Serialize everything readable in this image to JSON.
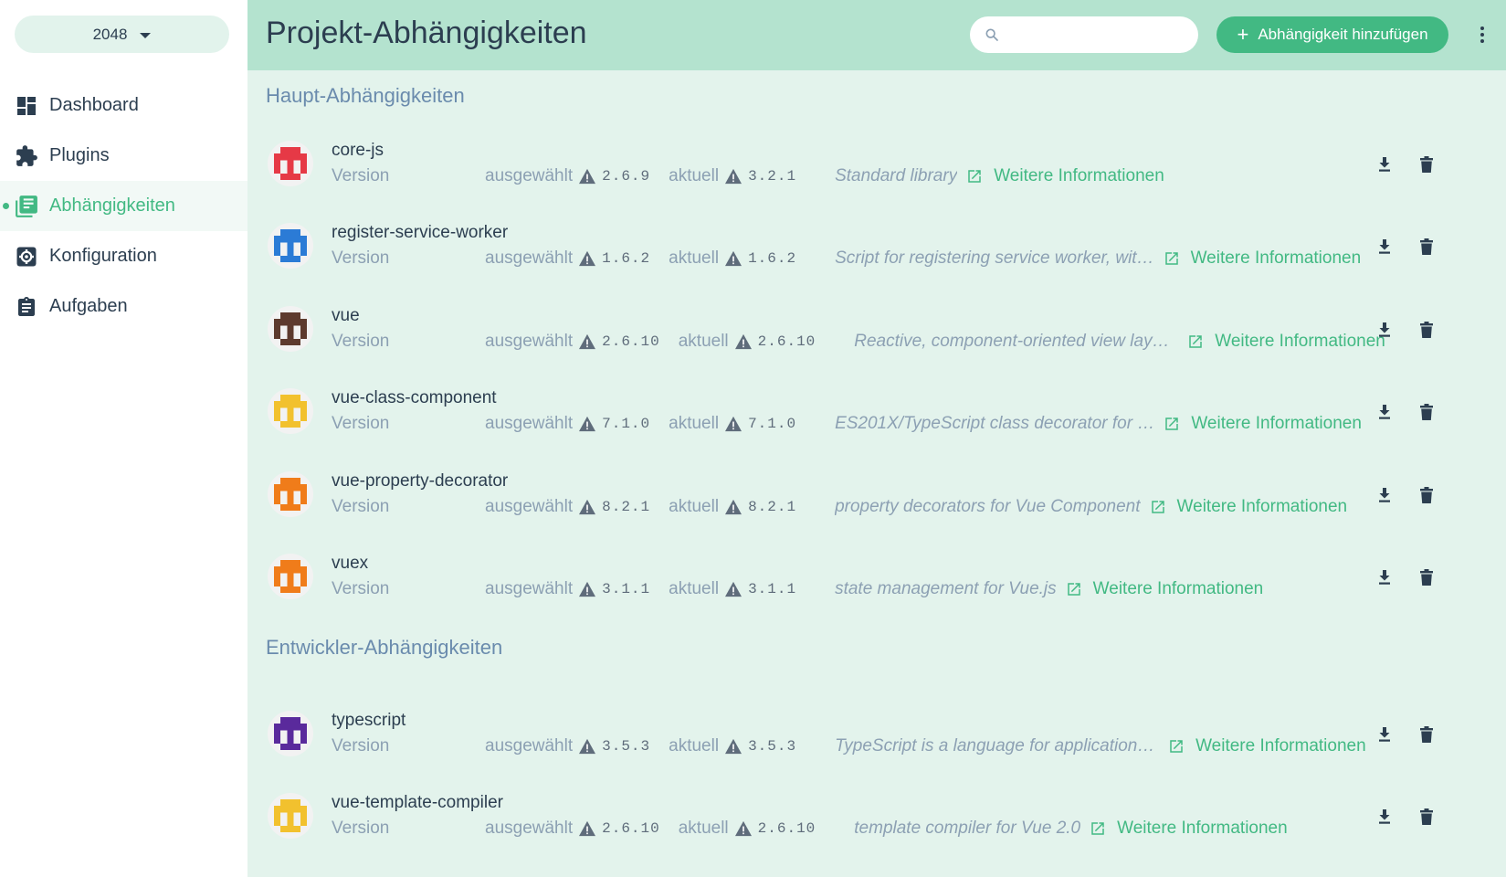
{
  "project_selector": {
    "value": "2048"
  },
  "nav": [
    {
      "label": "Dashboard",
      "icon": "dashboard-icon",
      "active": false
    },
    {
      "label": "Plugins",
      "icon": "puzzle-icon",
      "active": false
    },
    {
      "label": "Abhängigkeiten",
      "icon": "library-icon",
      "active": true
    },
    {
      "label": "Konfiguration",
      "icon": "settings-icon",
      "active": false
    },
    {
      "label": "Aufgaben",
      "icon": "clipboard-icon",
      "active": false
    }
  ],
  "header": {
    "title": "Projekt-Abhängigkeiten",
    "search_placeholder": "",
    "add_label": "Abhängigkeit hinzufügen"
  },
  "labels": {
    "version": "Version",
    "selected": "ausgewählt",
    "current": "aktuell",
    "more_info": "Weitere Informationen"
  },
  "sections": [
    {
      "title": "Haupt-Abhängigkeiten",
      "deps": [
        {
          "name": "core-js",
          "selected": "2.6.9",
          "current": "3.2.1",
          "description": "Standard library",
          "avatar_color": "#e63946"
        },
        {
          "name": "register-service-worker",
          "selected": "1.6.2",
          "current": "1.6.2",
          "description": "Script for registering service worker, wit…",
          "avatar_color": "#2b7bd6"
        },
        {
          "name": "vue",
          "selected": "2.6.10",
          "current": "2.6.10",
          "description": "Reactive, component-oriented view laye…",
          "avatar_color": "#5d3a2e"
        },
        {
          "name": "vue-class-component",
          "selected": "7.1.0",
          "current": "7.1.0",
          "description": "ES201X/TypeScript class decorator for …",
          "avatar_color": "#f2c12e"
        },
        {
          "name": "vue-property-decorator",
          "selected": "8.2.1",
          "current": "8.2.1",
          "description": "property decorators for Vue Component",
          "avatar_color": "#f07c1a"
        },
        {
          "name": "vuex",
          "selected": "3.1.1",
          "current": "3.1.1",
          "description": "state management for Vue.js",
          "avatar_color": "#f07c1a"
        }
      ]
    },
    {
      "title": "Entwickler-Abhängigkeiten",
      "deps": [
        {
          "name": "typescript",
          "selected": "3.5.3",
          "current": "3.5.3",
          "description": "TypeScript is a language for application …",
          "avatar_color": "#5a2a9c"
        },
        {
          "name": "vue-template-compiler",
          "selected": "2.6.10",
          "current": "2.6.10",
          "description": "template compiler for Vue 2.0",
          "avatar_color": "#f2c12e"
        }
      ]
    }
  ],
  "colors": {
    "accent": "#42b983",
    "header_bg": "#b4e3cf",
    "content_bg": "#e3f3ec",
    "text": "#2c3e50",
    "muted": "#8ca0b3",
    "section_title": "#6a8bad"
  }
}
